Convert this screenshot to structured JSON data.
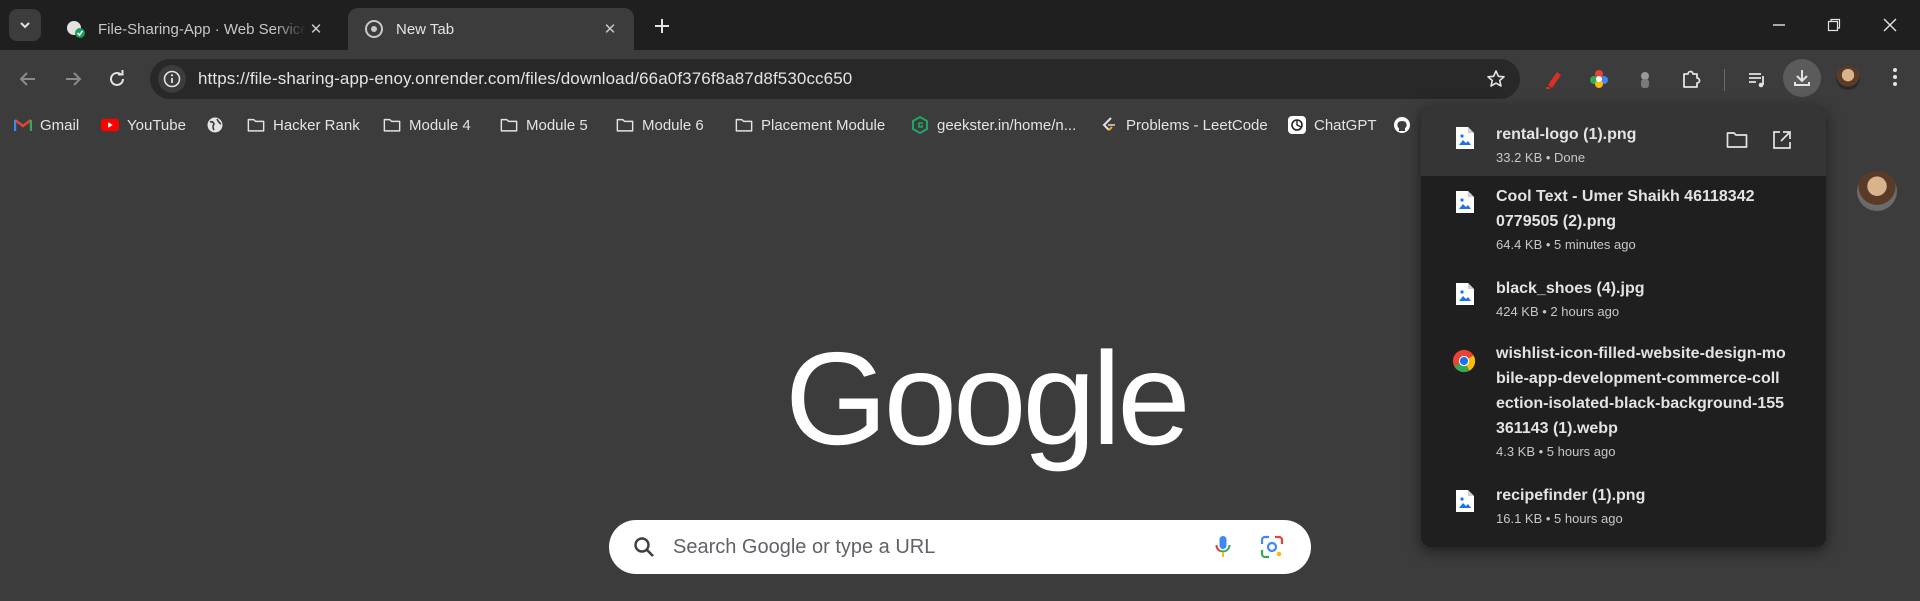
{
  "tabs": [
    {
      "title": "File-Sharing-App · Web Service",
      "active": false
    },
    {
      "title": "New Tab",
      "active": true
    }
  ],
  "toolbar": {
    "url": "https://file-sharing-app-enoy.onrender.com/files/download/66a0f376f8a87d8f530cc650"
  },
  "bookmarks": [
    {
      "label": "Gmail",
      "icon": "gmail-icon"
    },
    {
      "label": "YouTube",
      "icon": "youtube-icon"
    },
    {
      "label": "",
      "icon": "globe-icon"
    },
    {
      "label": "Hacker Rank",
      "icon": "folder-icon"
    },
    {
      "label": "Module 4",
      "icon": "folder-icon"
    },
    {
      "label": "Module 5",
      "icon": "folder-icon"
    },
    {
      "label": "Module 6",
      "icon": "folder-icon"
    },
    {
      "label": "Placement Module",
      "icon": "folder-icon"
    },
    {
      "label": "geekster.in/home/n...",
      "icon": "geekster-icon"
    },
    {
      "label": "Problems - LeetCode",
      "icon": "leetcode-icon"
    },
    {
      "label": "ChatGPT",
      "icon": "chatgpt-icon"
    },
    {
      "label": "",
      "icon": "github-icon"
    }
  ],
  "ntp": {
    "logo": "Google",
    "search_placeholder": "Search Google or type a URL"
  },
  "downloads": [
    {
      "name": "rental-logo (1).png",
      "meta": "33.2 KB • Done",
      "icon": "image-file-icon"
    },
    {
      "name": "Cool Text - Umer Shaikh 461183420779505 (2).png",
      "meta": "64.4 KB • 5 minutes ago",
      "icon": "image-file-icon"
    },
    {
      "name": "black_shoes (4).jpg",
      "meta": "424 KB • 2 hours ago",
      "icon": "image-file-icon"
    },
    {
      "name": "wishlist-icon-filled-website-design-mobile-app-development-commerce-collection-isolated-black-background-155361143 (1).webp",
      "meta": "4.3 KB • 5 hours ago",
      "icon": "chrome-icon"
    },
    {
      "name": "recipefinder (1).png",
      "meta": "16.1 KB • 5 hours ago",
      "icon": "image-file-icon"
    }
  ],
  "colors": {
    "frame": "#1f1f1f",
    "toolbar": "#3c3c3c",
    "omnibox": "#282828",
    "text": "#e3e3e3",
    "accent_blue": "#a8c7fa"
  }
}
